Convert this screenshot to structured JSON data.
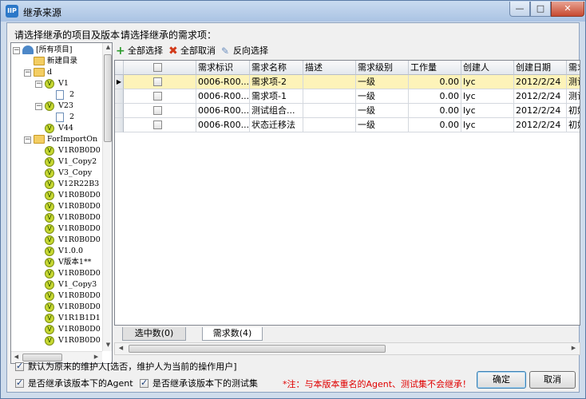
{
  "window": {
    "title": "继承来源",
    "controls": {
      "minimize": "—",
      "maximize": "□",
      "close": "✕"
    }
  },
  "prompts": {
    "left": "请选择继承的项目及版本：",
    "right": "请选择继承的需求项："
  },
  "tree": {
    "nodes": [
      {
        "label": "[所有项目]",
        "icon": "globe-icon"
      },
      {
        "label": "新建目录",
        "icon": "folder-icon"
      },
      {
        "label": "d",
        "icon": "folder-icon"
      },
      {
        "label": "V1",
        "icon": "version-icon"
      },
      {
        "label": "2",
        "icon": "page-icon"
      },
      {
        "label": "V23",
        "icon": "version-icon"
      },
      {
        "label": "2",
        "icon": "page-icon"
      },
      {
        "label": "V44",
        "icon": "version-icon"
      },
      {
        "label": "ForImportOn",
        "icon": "folder-icon"
      },
      {
        "label": "V1R0B0D0",
        "icon": "version-icon"
      },
      {
        "label": "V1_Copy2",
        "icon": "version-icon"
      },
      {
        "label": "V3_Copy",
        "icon": "version-icon"
      },
      {
        "label": "V12R22B3",
        "icon": "version-icon"
      },
      {
        "label": "V1R0B0D0",
        "icon": "version-icon"
      },
      {
        "label": "V1R0B0D0",
        "icon": "version-icon"
      },
      {
        "label": "V1R0B0D0",
        "icon": "version-icon"
      },
      {
        "label": "V1R0B0D0",
        "icon": "version-icon"
      },
      {
        "label": "V1R0B0D0",
        "icon": "version-icon"
      },
      {
        "label": "V1.0.0",
        "icon": "version-icon"
      },
      {
        "label": "V版本1**",
        "icon": "version-icon"
      },
      {
        "label": "V1R0B0D0",
        "icon": "version-icon"
      },
      {
        "label": "V1_Copy3",
        "icon": "version-icon"
      },
      {
        "label": "V1R0B0D0",
        "icon": "version-icon"
      },
      {
        "label": "V1R0B0D0",
        "icon": "version-icon"
      },
      {
        "label": "V1R1B1D1",
        "icon": "version-icon"
      },
      {
        "label": "V1R0B0D0",
        "icon": "version-icon"
      },
      {
        "label": "V1R0B0D0",
        "icon": "version-icon"
      }
    ]
  },
  "toolbar": {
    "select_all": "全部选择",
    "deselect_all": "全部取消",
    "invert": "反向选择"
  },
  "grid": {
    "columns": [
      "需求标识",
      "需求名称",
      "描述",
      "需求级别",
      "工作量",
      "创建人",
      "创建日期",
      "需求"
    ],
    "rows": [
      {
        "id": "0006-R00...",
        "name": "需求项-2",
        "desc": "",
        "level": "一级",
        "work": "0.00",
        "creator": "lyc",
        "date": "2012/2/24",
        "state": "测试"
      },
      {
        "id": "0006-R00...",
        "name": "需求项-1",
        "desc": "",
        "level": "一级",
        "work": "0.00",
        "creator": "lyc",
        "date": "2012/2/24",
        "state": "测试"
      },
      {
        "id": "0006-R00...",
        "name": "测试组合...",
        "desc": "",
        "level": "一级",
        "work": "0.00",
        "creator": "lyc",
        "date": "2012/2/24",
        "state": "初始"
      },
      {
        "id": "0006-R00...",
        "name": "状态迁移法",
        "desc": "",
        "level": "一级",
        "work": "0.00",
        "creator": "lyc",
        "date": "2012/2/24",
        "state": "初始"
      }
    ],
    "selected_row": 0,
    "highlight": "#fdf3b9"
  },
  "tabs": {
    "selected": "选中数(0)",
    "count": "需求数(4)"
  },
  "options": {
    "maintainer": "默认为原来的维护人[选否，维护人为当前的操作用户]",
    "inherit_agent": "是否继承该版本下的Agent",
    "inherit_testset": "是否继承该版本下的测试集"
  },
  "note": "*注：与本版本重名的Agent、测试集不会继承！",
  "buttons": {
    "ok": "确定",
    "cancel": "取消"
  }
}
